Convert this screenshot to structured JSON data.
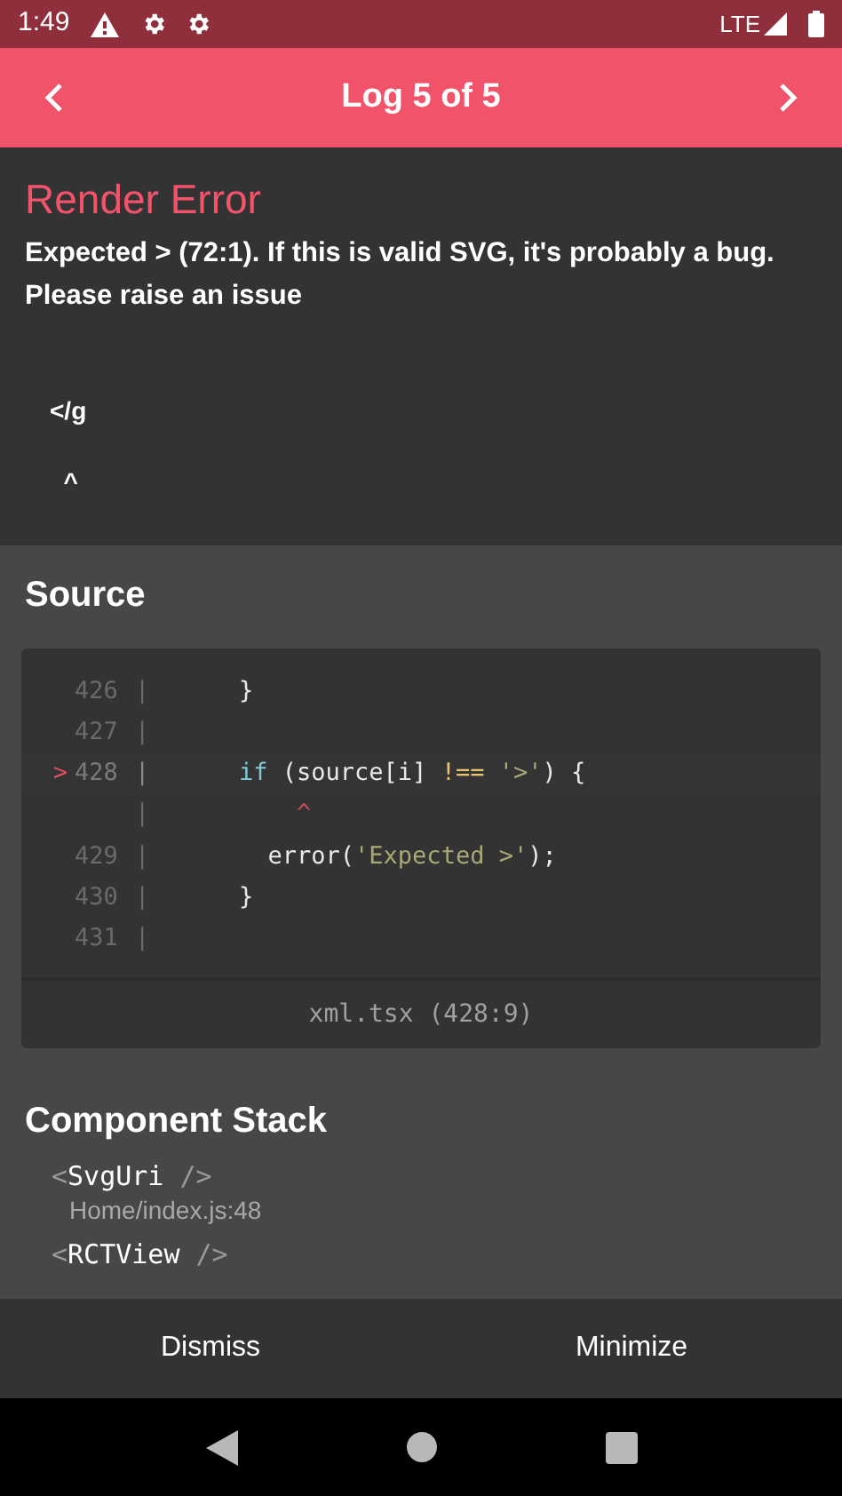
{
  "status_bar": {
    "time": "1:49",
    "network": "LTE"
  },
  "header": {
    "title": "Log 5 of 5"
  },
  "error": {
    "title": "Render Error",
    "message": "Expected > (72:1). If this is valid SVG, it's probably a bug. Please raise an issue",
    "code_lines": [
      "</g",
      "  ^"
    ]
  },
  "source": {
    "title": "Source",
    "lines": [
      {
        "number": "426",
        "gutter": "|",
        "highlighted": false,
        "tokens": [
          {
            "kind": "plain",
            "text": "    }"
          }
        ]
      },
      {
        "number": "427",
        "gutter": "|",
        "highlighted": false
      },
      {
        "number": "428",
        "gutter": "|",
        "highlighted": true,
        "marker": ">",
        "tokens": [
          {
            "kind": "keyword",
            "text": "    if"
          },
          {
            "kind": "plain",
            "text": " (source[i] "
          },
          {
            "kind": "operator",
            "text": "!=="
          },
          {
            "kind": "string",
            "text": " '>'"
          },
          {
            "kind": "plain",
            "text": ") {"
          }
        ]
      },
      {
        "gutter": "|",
        "highlighted": false,
        "tokens": [
          {
            "kind": "caret",
            "text": "        ^"
          }
        ]
      },
      {
        "number": "429",
        "gutter": "|",
        "highlighted": false,
        "tokens": [
          {
            "kind": "plain",
            "text": "      error("
          },
          {
            "kind": "string",
            "text": "'Expected >'"
          },
          {
            "kind": "plain",
            "text": ");"
          }
        ]
      },
      {
        "number": "430",
        "gutter": "|",
        "highlighted": false,
        "tokens": [
          {
            "kind": "plain",
            "text": "    }"
          }
        ]
      },
      {
        "number": "431",
        "gutter": "|",
        "highlighted": false
      }
    ],
    "file": "xml.tsx (428:9)"
  },
  "component_stack": {
    "title": "Component Stack",
    "items": [
      {
        "open": "<",
        "name": "SvgUri",
        "close": " />",
        "location": "Home/index.js:48"
      },
      {
        "open": "<",
        "name": "RCTView",
        "close": " />"
      }
    ]
  },
  "buttons": [
    {
      "label": "Dismiss"
    },
    {
      "label": "Minimize"
    }
  ]
}
